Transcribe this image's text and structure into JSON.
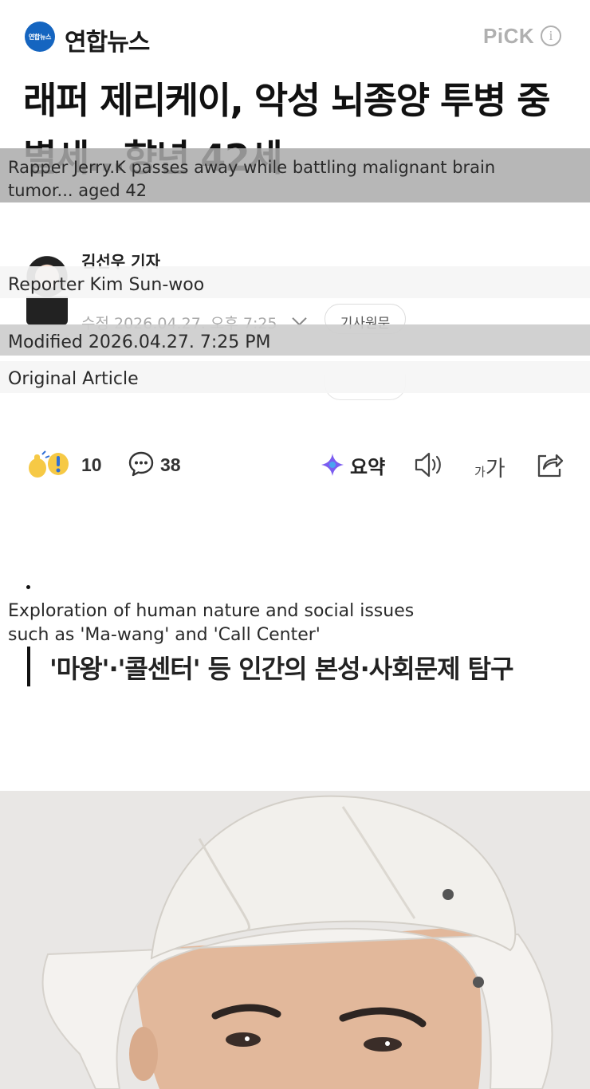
{
  "header": {
    "logo_text": "연합뉴스",
    "brand_name": "연합뉴스",
    "pick_label": "PiCK",
    "info_symbol": "i"
  },
  "article": {
    "headline": "래퍼 제리케이, 악성 뇌종양 투병 중 별세…향년 42세",
    "reporter": "김선우 기자",
    "modified": "수정 2026.04.27. 오후 7:25",
    "original_button": "기사원문",
    "subtitle": "'마왕'·'콜센터' 등 인간의 본성·사회문제 탐구"
  },
  "actions": {
    "reaction_count": "10",
    "comment_count": "38",
    "summary_label": "요약",
    "font_size_small": "가",
    "font_size_large": "가"
  },
  "translations": {
    "headline": "Rapper Jerry.K passes away while battling malignant brain tumor... aged 42",
    "reporter": "Reporter Kim Sun-woo",
    "modified": "Modified 2026.04.27. 7:25 PM",
    "original": "Original Article",
    "subtitle_line1": "Exploration of human nature and social issues",
    "subtitle_line2": "such as 'Ma-wang' and 'Call Center'"
  },
  "colors": {
    "brand_blue": "#1565c0",
    "pick_gray": "#b0b0b0",
    "overlay_dark": "#aaaaaa",
    "overlay_mid": "#cdcdcd",
    "overlay_light": "#f5f5f5"
  },
  "icons": [
    "info-icon",
    "reaction-icon",
    "comment-icon",
    "summary-sparkle-icon",
    "speaker-icon",
    "share-icon"
  ]
}
